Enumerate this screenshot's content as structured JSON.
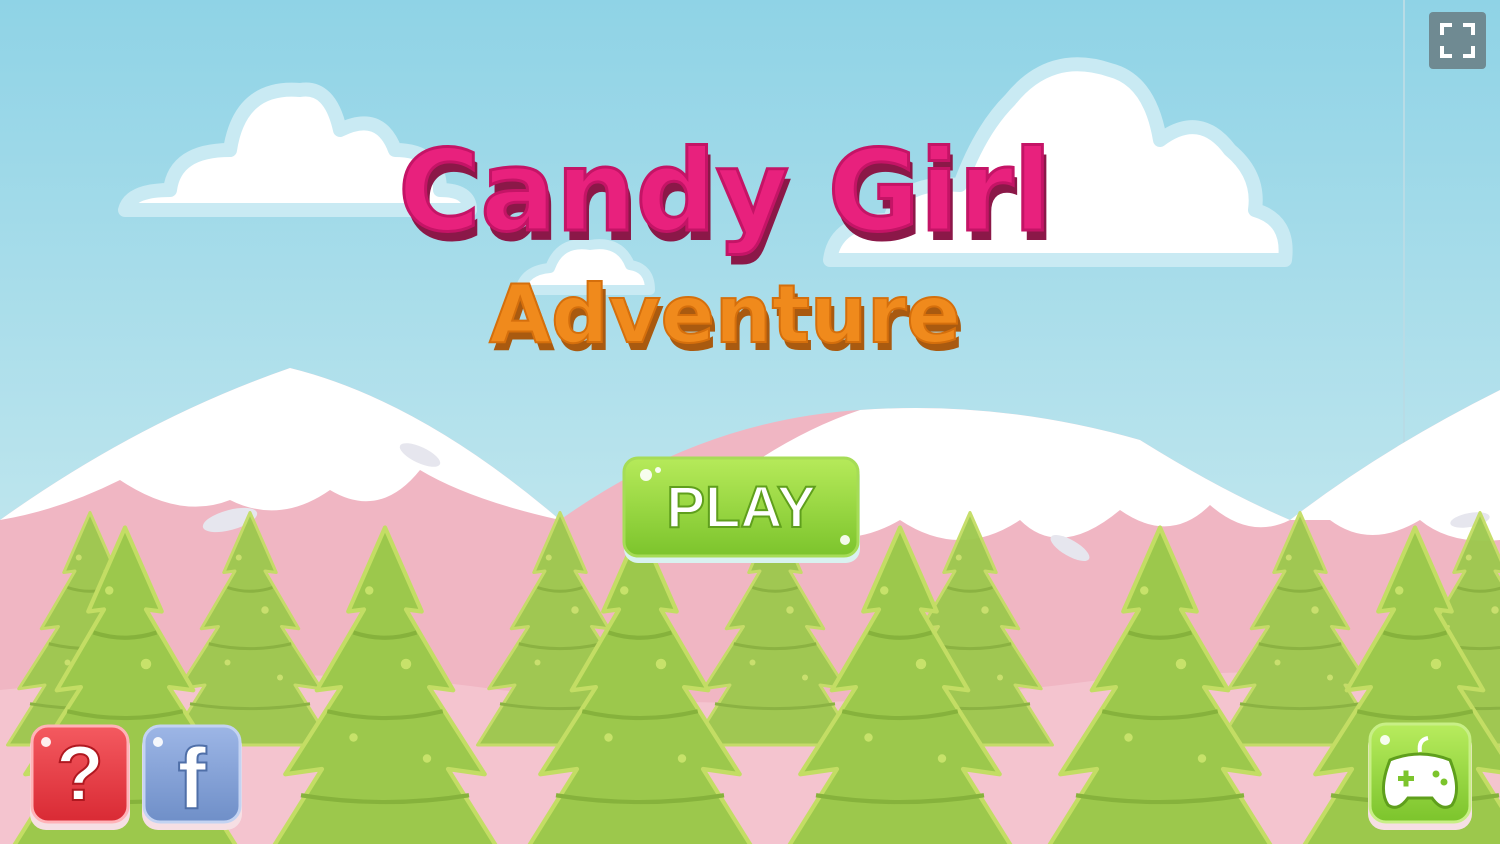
{
  "game": {
    "title_line1": "Candy Girl",
    "title_line2": "Adventure",
    "play_label": "PLAY",
    "help_label": "?",
    "facebook_label": "f"
  },
  "icons": {
    "fullscreen": "fullscreen-icon",
    "help": "question-mark-icon",
    "facebook": "facebook-icon",
    "more_games": "gamepad-icon"
  },
  "colors": {
    "sky_top": "#8fd3e6",
    "sky_bottom": "#d6eff3",
    "title_pink": "#e8217d",
    "title_orange": "#f08a1c",
    "play_green": "#8fd43a",
    "help_red": "#e8363f",
    "facebook_blue": "#7f9fd6",
    "mountain_pink": "#f0b6c3",
    "snow": "#ffffff",
    "tree_green": "#9cc84c"
  }
}
